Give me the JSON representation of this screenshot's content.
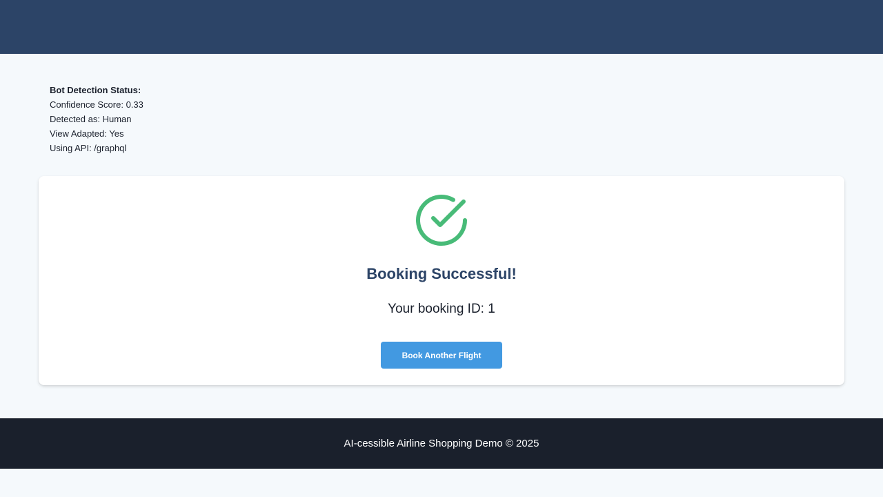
{
  "header": {
    "background_color": "#2c4467"
  },
  "bot_detection": {
    "title": "Bot Detection Status:",
    "confidence": "Confidence Score: 0.33",
    "detected_as": "Detected as: Human",
    "view_adapted": "View Adapted: Yes",
    "api": "Using API: /graphql"
  },
  "confirmation": {
    "icon": "check-circle-icon",
    "icon_color": "#48bb78",
    "title": "Booking Successful!",
    "booking_id_text": "Your booking ID: 1",
    "button_label": "Book Another Flight",
    "button_color": "#4299e1"
  },
  "footer": {
    "text": "AI-cessible Airline Shopping Demo © 2025",
    "background_color": "#1a202c"
  }
}
